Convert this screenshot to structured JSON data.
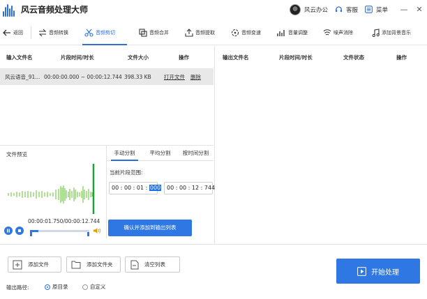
{
  "app": {
    "title": "风云音频处理大师"
  },
  "titlebar": {
    "user": "风云办公",
    "support": "客服",
    "menu": "菜单",
    "minimize": "—",
    "close": "✕"
  },
  "toolbar": {
    "back": "返回",
    "items": [
      {
        "label": "音频转换",
        "icon": "convert-icon",
        "active": false
      },
      {
        "label": "音频剪切",
        "icon": "scissors-icon",
        "active": true
      },
      {
        "label": "音频合并",
        "icon": "merge-icon",
        "active": false
      },
      {
        "label": "音频提取",
        "icon": "extract-icon",
        "active": false
      },
      {
        "label": "音频变速",
        "icon": "speed-icon",
        "active": false
      },
      {
        "label": "音量调整",
        "icon": "volume-bars-icon",
        "active": false
      },
      {
        "label": "噪声消除",
        "icon": "noise-icon",
        "active": false
      },
      {
        "label": "添加背景音乐",
        "icon": "music-icon",
        "active": false
      }
    ]
  },
  "input_table": {
    "headers": [
      "输入文件名",
      "片段时间/时长",
      "文件大小",
      "操作"
    ],
    "rows": [
      {
        "name": "风云语音_91...",
        "range": "00:00:00.000 ~ 00:00:12.744",
        "size": "398.33 KB",
        "open": "打开文件",
        "delete": "删除"
      }
    ]
  },
  "output_table": {
    "headers": [
      "输出文件名",
      "片段时间/时长",
      "文件状态",
      "操作"
    ]
  },
  "preview": {
    "label": "文件预览",
    "time": "00:00:01.750/00:00:12.744"
  },
  "split": {
    "tabs": [
      "手动分割",
      "平均分割",
      "按时间分割"
    ],
    "range_label": "当前片段范围:",
    "start_prefix": "00 : 00 : 01 : ",
    "start_sel": "000",
    "end": "00 : 00 : 12 : 744",
    "confirm": "确认并添加到输出列表"
  },
  "bottom": {
    "add_file": "添加文件",
    "add_folder": "添加文件夹",
    "clear": "清空列表",
    "output_label": "输出路径:",
    "opt_original": "原目录",
    "opt_custom": "自定义",
    "start": "开始处理"
  },
  "colors": {
    "accent": "#2f78e3",
    "wave": "#5fc22b",
    "selected_row": "#e8e8e8"
  }
}
